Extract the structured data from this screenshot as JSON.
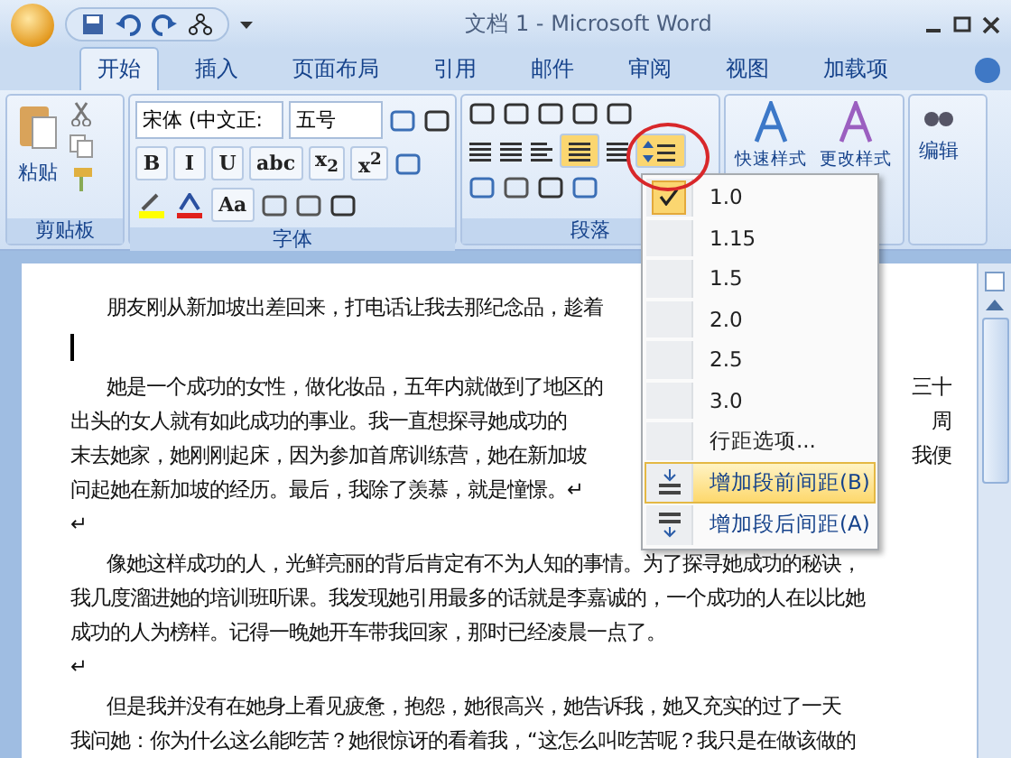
{
  "window": {
    "title": "文档 1 - Microsoft Word"
  },
  "tabs": [
    {
      "label": "开始",
      "selected": true
    },
    {
      "label": "插入",
      "selected": false
    },
    {
      "label": "页面布局",
      "selected": false
    },
    {
      "label": "引用",
      "selected": false
    },
    {
      "label": "邮件",
      "selected": false
    },
    {
      "label": "审阅",
      "selected": false
    },
    {
      "label": "视图",
      "selected": false
    },
    {
      "label": "加载项",
      "selected": false
    }
  ],
  "clipboard": {
    "paste": "粘贴",
    "label": "剪贴板"
  },
  "font": {
    "name": "宋体 (中文正:",
    "size": "五号",
    "style_buttons": [
      "B",
      "I",
      "U",
      "abc",
      "x$_{2}$",
      "x$^{2}$"
    ],
    "case_button": "Aa",
    "label": "字体"
  },
  "paragraph": {
    "label": "段落",
    "line_spacing_selected": true
  },
  "styles": [
    "快速样式",
    "更改样式"
  ],
  "editing": "编辑",
  "line_spacing_menu": [
    {
      "label": "1.0",
      "kind": "value",
      "checked": true,
      "selected": false
    },
    {
      "label": "1.15",
      "kind": "value",
      "checked": false,
      "selected": false
    },
    {
      "label": "1.5",
      "kind": "value",
      "checked": false,
      "selected": false
    },
    {
      "label": "2.0",
      "kind": "value",
      "checked": false,
      "selected": false
    },
    {
      "label": "2.5",
      "kind": "value",
      "checked": false,
      "selected": false
    },
    {
      "label": "3.0",
      "kind": "value",
      "checked": false,
      "selected": false
    },
    {
      "label": "行距选项...",
      "kind": "option",
      "checked": false,
      "selected": false
    },
    {
      "label": "增加段前间距(B)",
      "kind": "before",
      "checked": false,
      "selected": true
    },
    {
      "label": "增加段后间距(A)",
      "kind": "after",
      "checked": false,
      "selected": false
    }
  ],
  "document": [
    {
      "text": "朋友刚从新加坡出差回来，打电话让我去那纪念品，趁着",
      "indent": true
    },
    {
      "cursor": true
    },
    {
      "text": "她是一个成功的女性，做化妆品，五年内就做到了地区的",
      "tail": "三十",
      "indent": true
    },
    {
      "text": "出头的女人就有如此成功的事业。我一直想探寻她成功的",
      "tail": "周"
    },
    {
      "text": "末去她家，她刚刚起床，因为参加首席训练营，她在新加坡",
      "tail": "我便"
    },
    {
      "text": "问起她在新加坡的经历。最后，我除了羡慕，就是憧憬。↵"
    },
    {
      "text": "↵"
    },
    {
      "text": "像她这样成功的人，光鲜亮丽的背后肯定有不为人知的事情。为了探寻她成功的秘诀，",
      "indent": true
    },
    {
      "text": "我几度溜进她的培训班听课。我发现她引用最多的话就是李嘉诚的，一个成功的人在以比她"
    },
    {
      "text": "成功的人为榜样。记得一晚她开车带我回家，那时已经凌晨一点了。"
    },
    {
      "text": "↵"
    },
    {
      "text": "但是我并没有在她身上看见疲惫，抱怨，她很高兴，她告诉我，她又充实的过了一天",
      "indent": true
    },
    {
      "text": "我问她：你为什么这么能吃苦？她很惊讶的看着我，“这怎么叫吃苦呢？我只是在做该做的"
    }
  ]
}
